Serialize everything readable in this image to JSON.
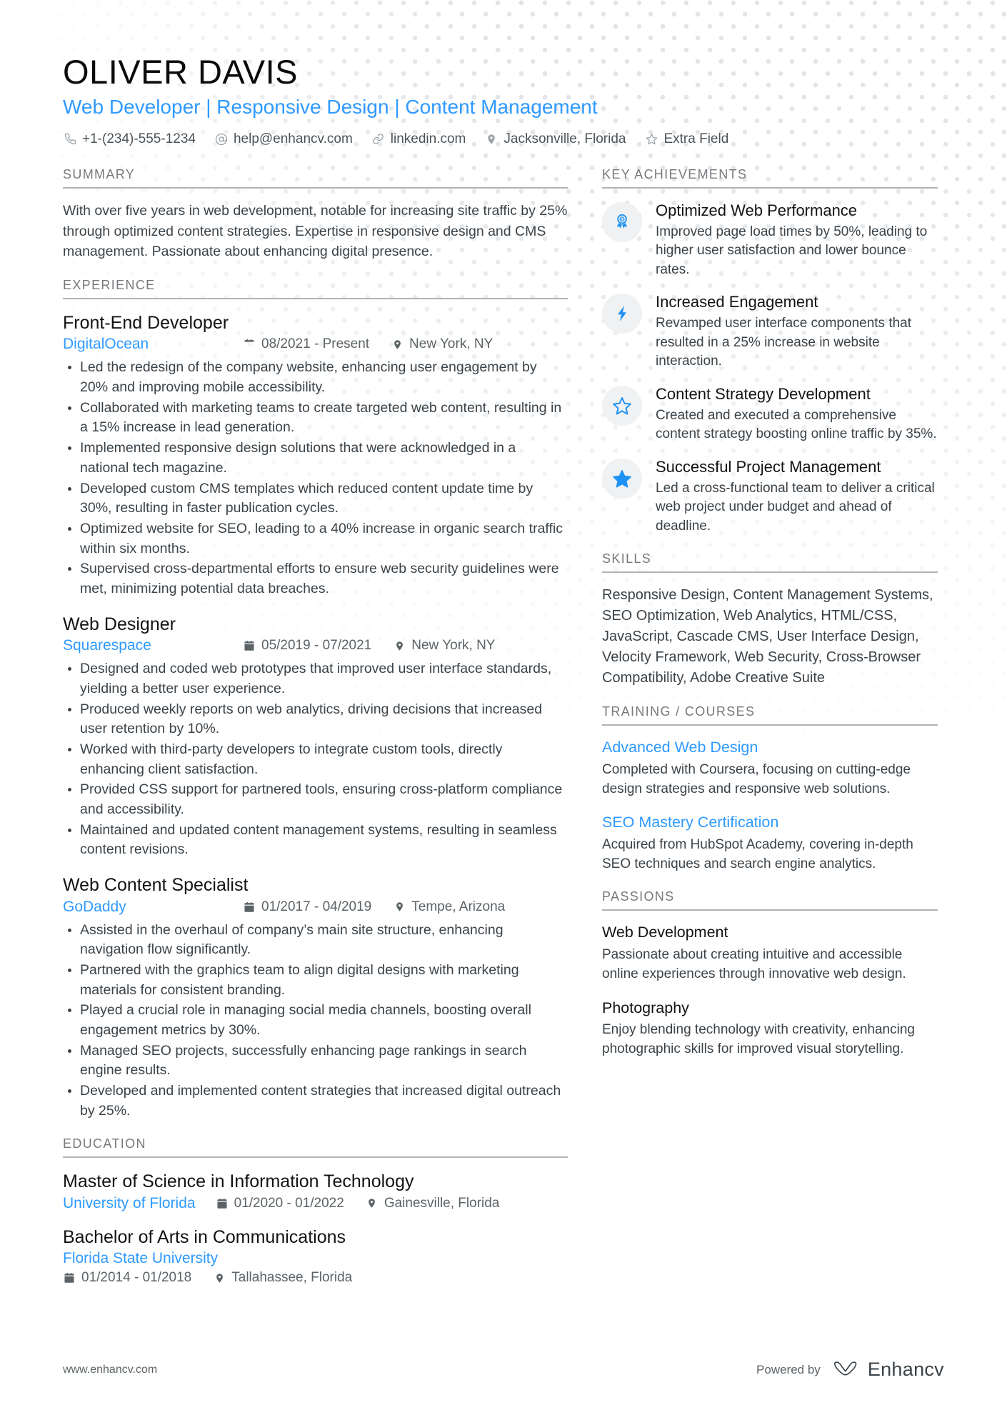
{
  "header": {
    "name": "OLIVER DAVIS",
    "title": "Web Developer | Responsive Design | Content Management",
    "accent_color": "#2f9aff",
    "contacts": [
      {
        "icon": "phone-icon",
        "text": "+1-(234)-555-1234"
      },
      {
        "icon": "email-icon",
        "text": "help@enhancv.com"
      },
      {
        "icon": "link-icon",
        "text": "linkedin.com"
      },
      {
        "icon": "location-icon",
        "text": "Jacksonville, Florida"
      },
      {
        "icon": "star-icon",
        "text": "Extra Field"
      }
    ]
  },
  "summary": {
    "heading": "SUMMARY",
    "text": "With over five years in web development, notable for increasing site traffic by 25% through optimized content strategies. Expertise in responsive design and CMS management. Passionate about enhancing digital presence."
  },
  "experience": {
    "heading": "EXPERIENCE",
    "entries": [
      {
        "title": "Front-End Developer",
        "organization": "DigitalOcean",
        "dates": "08/2021 - Present",
        "location": "New York, NY",
        "bullets": [
          "Led the redesign of the company website, enhancing user engagement by 20% and improving mobile accessibility.",
          "Collaborated with marketing teams to create targeted web content, resulting in a 15% increase in lead generation.",
          "Implemented responsive design solutions that were acknowledged in a national tech magazine.",
          "Developed custom CMS templates which reduced content update time by 30%, resulting in faster publication cycles.",
          "Optimized website for SEO, leading to a 40% increase in organic search traffic within six months.",
          "Supervised cross-departmental efforts to ensure web security guidelines were met, minimizing potential data breaches."
        ]
      },
      {
        "title": "Web Designer",
        "organization": "Squarespace",
        "dates": "05/2019 - 07/2021",
        "location": "New York, NY",
        "bullets": [
          "Designed and coded web prototypes that improved user interface standards, yielding a better user experience.",
          "Produced weekly reports on web analytics, driving decisions that increased user retention by 10%.",
          "Worked with third-party developers to integrate custom tools, directly enhancing client satisfaction.",
          "Provided CSS support for partnered tools, ensuring cross-platform compliance and accessibility.",
          "Maintained and updated content management systems, resulting in seamless content revisions."
        ]
      },
      {
        "title": "Web Content Specialist",
        "organization": "GoDaddy",
        "dates": "01/2017 - 04/2019",
        "location": "Tempe, Arizona",
        "bullets": [
          "Assisted in the overhaul of company’s main site structure, enhancing navigation flow significantly.",
          "Partnered with the graphics team to align digital designs with marketing materials for consistent branding.",
          "Played a crucial role in managing social media channels, boosting overall engagement metrics by 30%.",
          "Managed SEO projects, successfully enhancing page rankings in search engine results.",
          "Developed and implemented content strategies that increased digital outreach by 25%."
        ]
      }
    ]
  },
  "education": {
    "heading": "EDUCATION",
    "entries": [
      {
        "title": "Master of Science in Information Technology",
        "organization": "University of Florida",
        "dates": "01/2020 - 01/2022",
        "location": "Gainesville, Florida",
        "wrapped": false
      },
      {
        "title": "Bachelor of Arts in Communications",
        "organization": "Florida State University",
        "dates": "01/2014 - 01/2018",
        "location": "Tallahassee, Florida",
        "wrapped": true
      }
    ]
  },
  "key_achievements": {
    "heading": "KEY ACHIEVEMENTS",
    "items": [
      {
        "icon": "award-ribbon-icon",
        "title": "Optimized Web Performance",
        "description": "Improved page load times by 50%, leading to higher user satisfaction and lower bounce rates."
      },
      {
        "icon": "lightning-bolt-icon",
        "title": "Increased Engagement",
        "description": "Revamped user interface components that resulted in a 25% increase in website interaction."
      },
      {
        "icon": "star-outline-icon",
        "title": "Content Strategy Development",
        "description": "Created and executed a comprehensive content strategy boosting online traffic by 35%."
      },
      {
        "icon": "star-filled-icon",
        "title": "Successful Project Management",
        "description": "Led a cross-functional team to deliver a critical web project under budget and ahead of deadline."
      }
    ]
  },
  "skills": {
    "heading": "SKILLS",
    "text": "Responsive Design, Content Management Systems, SEO Optimization, Web Analytics, HTML/CSS, JavaScript, Cascade CMS, User Interface Design, Velocity Framework, Web Security, Cross-Browser Compatibility, Adobe Creative Suite"
  },
  "training": {
    "heading": "TRAINING / COURSES",
    "items": [
      {
        "title": "Advanced Web Design",
        "description": "Completed with Coursera, focusing on cutting-edge design strategies and responsive web solutions."
      },
      {
        "title": "SEO Mastery Certification",
        "description": "Acquired from HubSpot Academy, covering in-depth SEO techniques and search engine analytics."
      }
    ]
  },
  "passions": {
    "heading": "PASSIONS",
    "items": [
      {
        "title": "Web Development",
        "description": "Passionate about creating intuitive and accessible online experiences through innovative web design."
      },
      {
        "title": "Photography",
        "description": "Enjoy blending technology with creativity, enhancing photographic skills for improved visual storytelling."
      }
    ]
  },
  "footer": {
    "url": "www.enhancv.com",
    "powered_by": "Powered by",
    "brand": "Enhancv"
  }
}
